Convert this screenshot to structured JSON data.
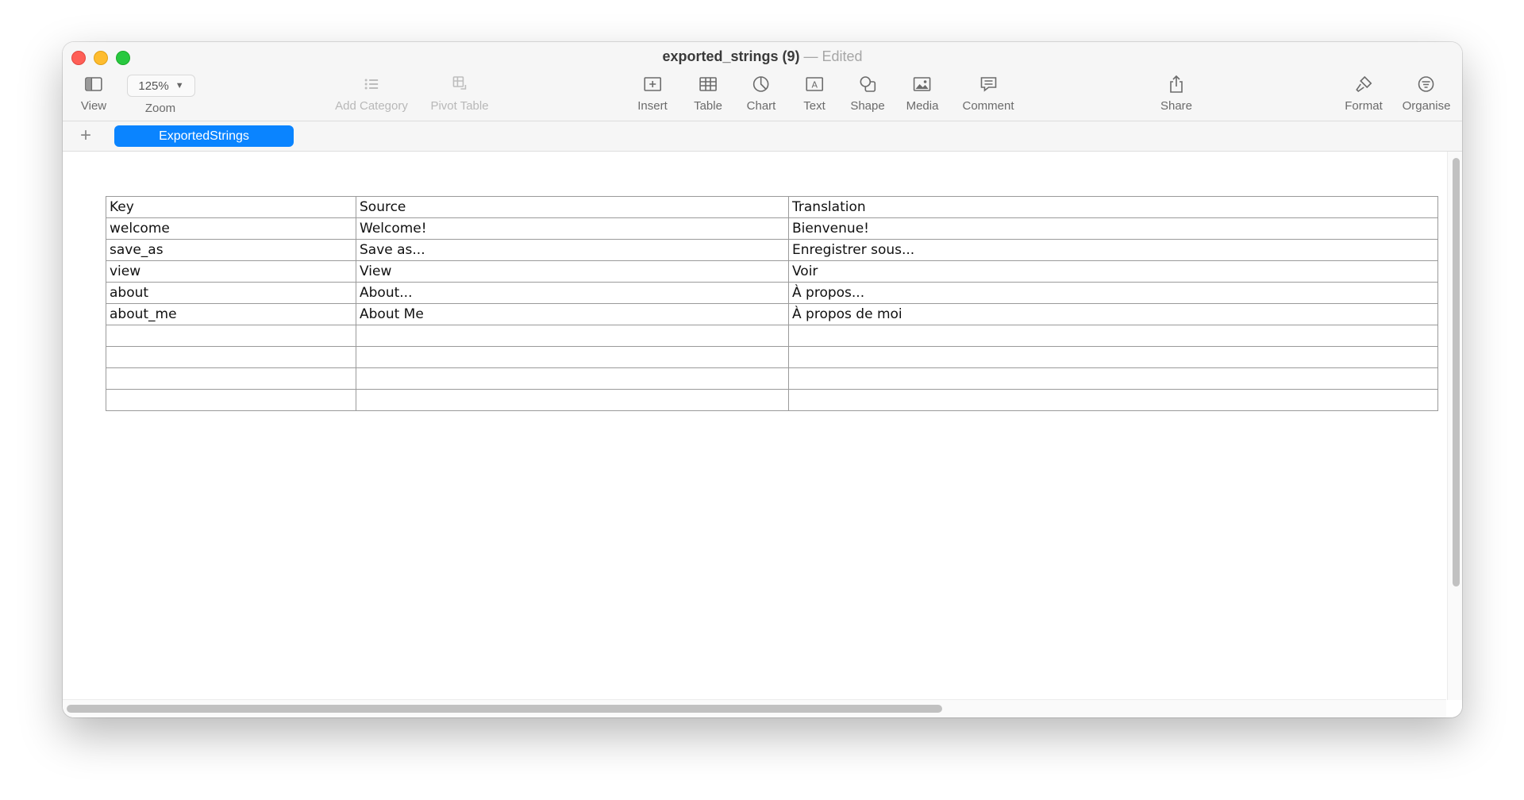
{
  "window": {
    "file_name": "exported_strings (9)",
    "separator": "—",
    "status": "Edited"
  },
  "toolbar": {
    "view": "View",
    "zoom_value": "125%",
    "zoom": "Zoom",
    "add_category": "Add Category",
    "pivot_table": "Pivot Table",
    "insert": "Insert",
    "table": "Table",
    "chart": "Chart",
    "text": "Text",
    "shape": "Shape",
    "media": "Media",
    "comment": "Comment",
    "share": "Share",
    "format": "Format",
    "organise": "Organise"
  },
  "sheets": {
    "add": "+",
    "active": "ExportedStrings"
  },
  "table": {
    "rows": [
      [
        "Key",
        "Source",
        "Translation"
      ],
      [
        "welcome",
        "Welcome!",
        "Bienvenue!"
      ],
      [
        "save_as",
        "Save as...",
        "Enregistrer sous..."
      ],
      [
        "view",
        "View",
        "Voir"
      ],
      [
        "about",
        "About...",
        "À propos..."
      ],
      [
        "about_me",
        "About Me",
        "À propos de moi"
      ],
      [
        "",
        "",
        ""
      ],
      [
        "",
        "",
        ""
      ],
      [
        "",
        "",
        ""
      ],
      [
        "",
        "",
        ""
      ]
    ]
  },
  "colors": {
    "accent": "#0a84ff",
    "close": "#ff5f57",
    "minimize": "#febc2e",
    "maximize": "#28c840"
  }
}
